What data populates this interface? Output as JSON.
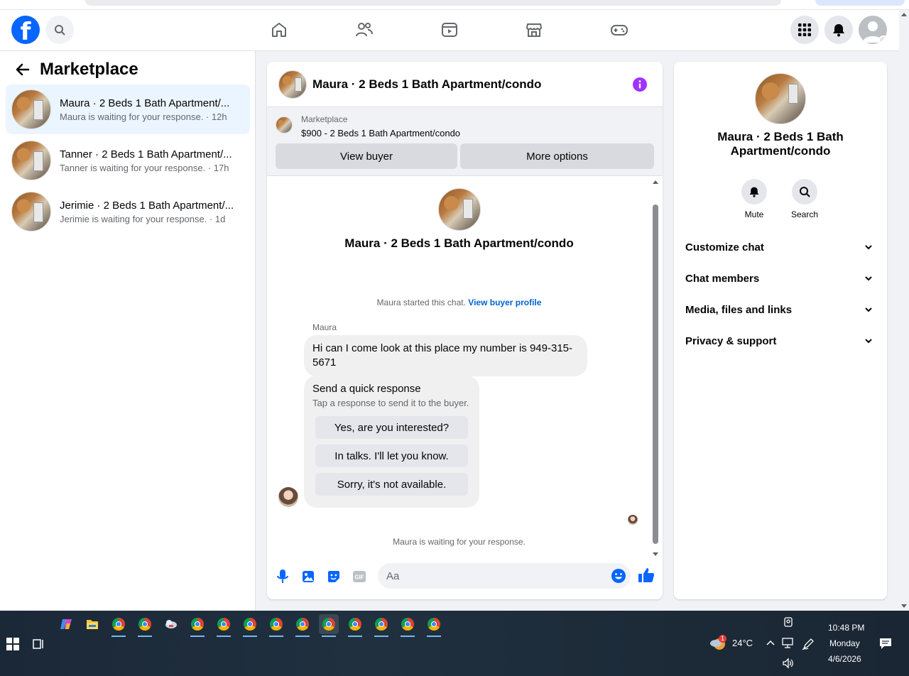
{
  "header": {
    "logo_letter": "f",
    "nav": [
      "home-icon",
      "friends-icon",
      "video-icon",
      "marketplace-icon",
      "gaming-icon"
    ]
  },
  "sidebar": {
    "title": "Marketplace",
    "conversations": [
      {
        "title": "Maura · 2 Beds 1 Bath Apartment/...",
        "subtitle": "Maura is waiting for your response. · 12h",
        "active": true
      },
      {
        "title": "Tanner · 2 Beds 1 Bath Apartment/...",
        "subtitle": "Tanner is waiting for your response. · 17h",
        "active": false
      },
      {
        "title": "Jerimie · 2 Beds 1 Bath Apartment/...",
        "subtitle": "Jerimie is waiting for your response. · 1d",
        "active": false
      }
    ]
  },
  "chat": {
    "title": "Maura · 2 Beds 1 Bath Apartment/condo",
    "listing": {
      "source": "Marketplace",
      "price_title": "$900 - 2 Beds 1 Bath Apartment/condo",
      "view_buyer": "View buyer",
      "more_options": "More options"
    },
    "thread": {
      "header_title": "Maura · 2 Beds 1 Bath Apartment/condo",
      "started_text": "Maura started this chat.",
      "started_link": "View buyer profile",
      "sender": "Maura",
      "message": "Hi can I come look at this place my number is 949-315-5671",
      "quick_title": "Send a quick response",
      "quick_sub": "Tap a response to send it to the buyer.",
      "quick_replies": [
        "Yes, are you interested?",
        "In talks. I'll let you know.",
        "Sorry, it's not available."
      ],
      "waiting": "Maura is waiting for your response."
    },
    "composer": {
      "placeholder": "Aa"
    }
  },
  "info": {
    "title": "Maura · 2 Beds 1 Bath Apartment/condo",
    "mute": "Mute",
    "search": "Search",
    "sections": [
      "Customize chat",
      "Chat members",
      "Media, files and links",
      "Privacy & support"
    ]
  },
  "taskbar": {
    "weather_temp": "24°C",
    "weather_badge": "1",
    "time": "10:48 PM",
    "day": "Monday",
    "date": "4/6/2026"
  },
  "colors": {
    "brand": "#0866ff",
    "accent_purple": "#a033ff",
    "link": "#0064d1"
  }
}
